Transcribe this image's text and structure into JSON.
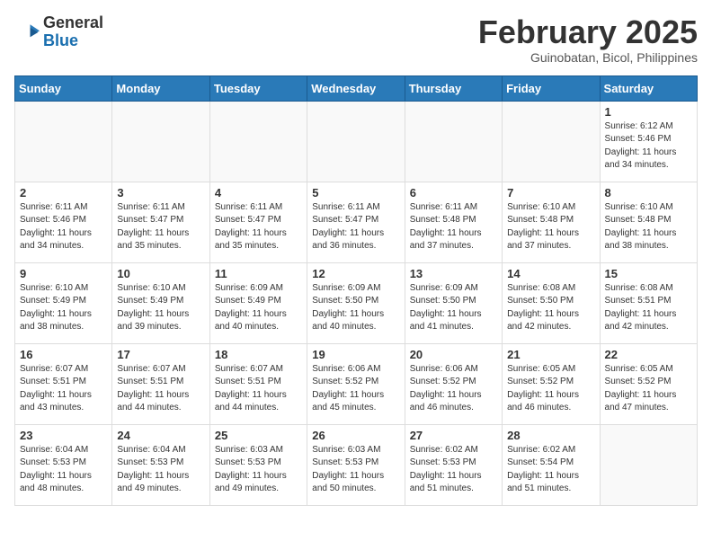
{
  "header": {
    "logo_general": "General",
    "logo_blue": "Blue",
    "month_year": "February 2025",
    "location": "Guinobatan, Bicol, Philippines"
  },
  "weekdays": [
    "Sunday",
    "Monday",
    "Tuesday",
    "Wednesday",
    "Thursday",
    "Friday",
    "Saturday"
  ],
  "weeks": [
    [
      {
        "day": "",
        "info": ""
      },
      {
        "day": "",
        "info": ""
      },
      {
        "day": "",
        "info": ""
      },
      {
        "day": "",
        "info": ""
      },
      {
        "day": "",
        "info": ""
      },
      {
        "day": "",
        "info": ""
      },
      {
        "day": "1",
        "info": "Sunrise: 6:12 AM\nSunset: 5:46 PM\nDaylight: 11 hours\nand 34 minutes."
      }
    ],
    [
      {
        "day": "2",
        "info": "Sunrise: 6:11 AM\nSunset: 5:46 PM\nDaylight: 11 hours\nand 34 minutes."
      },
      {
        "day": "3",
        "info": "Sunrise: 6:11 AM\nSunset: 5:47 PM\nDaylight: 11 hours\nand 35 minutes."
      },
      {
        "day": "4",
        "info": "Sunrise: 6:11 AM\nSunset: 5:47 PM\nDaylight: 11 hours\nand 35 minutes."
      },
      {
        "day": "5",
        "info": "Sunrise: 6:11 AM\nSunset: 5:47 PM\nDaylight: 11 hours\nand 36 minutes."
      },
      {
        "day": "6",
        "info": "Sunrise: 6:11 AM\nSunset: 5:48 PM\nDaylight: 11 hours\nand 37 minutes."
      },
      {
        "day": "7",
        "info": "Sunrise: 6:10 AM\nSunset: 5:48 PM\nDaylight: 11 hours\nand 37 minutes."
      },
      {
        "day": "8",
        "info": "Sunrise: 6:10 AM\nSunset: 5:48 PM\nDaylight: 11 hours\nand 38 minutes."
      }
    ],
    [
      {
        "day": "9",
        "info": "Sunrise: 6:10 AM\nSunset: 5:49 PM\nDaylight: 11 hours\nand 38 minutes."
      },
      {
        "day": "10",
        "info": "Sunrise: 6:10 AM\nSunset: 5:49 PM\nDaylight: 11 hours\nand 39 minutes."
      },
      {
        "day": "11",
        "info": "Sunrise: 6:09 AM\nSunset: 5:49 PM\nDaylight: 11 hours\nand 40 minutes."
      },
      {
        "day": "12",
        "info": "Sunrise: 6:09 AM\nSunset: 5:50 PM\nDaylight: 11 hours\nand 40 minutes."
      },
      {
        "day": "13",
        "info": "Sunrise: 6:09 AM\nSunset: 5:50 PM\nDaylight: 11 hours\nand 41 minutes."
      },
      {
        "day": "14",
        "info": "Sunrise: 6:08 AM\nSunset: 5:50 PM\nDaylight: 11 hours\nand 42 minutes."
      },
      {
        "day": "15",
        "info": "Sunrise: 6:08 AM\nSunset: 5:51 PM\nDaylight: 11 hours\nand 42 minutes."
      }
    ],
    [
      {
        "day": "16",
        "info": "Sunrise: 6:07 AM\nSunset: 5:51 PM\nDaylight: 11 hours\nand 43 minutes."
      },
      {
        "day": "17",
        "info": "Sunrise: 6:07 AM\nSunset: 5:51 PM\nDaylight: 11 hours\nand 44 minutes."
      },
      {
        "day": "18",
        "info": "Sunrise: 6:07 AM\nSunset: 5:51 PM\nDaylight: 11 hours\nand 44 minutes."
      },
      {
        "day": "19",
        "info": "Sunrise: 6:06 AM\nSunset: 5:52 PM\nDaylight: 11 hours\nand 45 minutes."
      },
      {
        "day": "20",
        "info": "Sunrise: 6:06 AM\nSunset: 5:52 PM\nDaylight: 11 hours\nand 46 minutes."
      },
      {
        "day": "21",
        "info": "Sunrise: 6:05 AM\nSunset: 5:52 PM\nDaylight: 11 hours\nand 46 minutes."
      },
      {
        "day": "22",
        "info": "Sunrise: 6:05 AM\nSunset: 5:52 PM\nDaylight: 11 hours\nand 47 minutes."
      }
    ],
    [
      {
        "day": "23",
        "info": "Sunrise: 6:04 AM\nSunset: 5:53 PM\nDaylight: 11 hours\nand 48 minutes."
      },
      {
        "day": "24",
        "info": "Sunrise: 6:04 AM\nSunset: 5:53 PM\nDaylight: 11 hours\nand 49 minutes."
      },
      {
        "day": "25",
        "info": "Sunrise: 6:03 AM\nSunset: 5:53 PM\nDaylight: 11 hours\nand 49 minutes."
      },
      {
        "day": "26",
        "info": "Sunrise: 6:03 AM\nSunset: 5:53 PM\nDaylight: 11 hours\nand 50 minutes."
      },
      {
        "day": "27",
        "info": "Sunrise: 6:02 AM\nSunset: 5:53 PM\nDaylight: 11 hours\nand 51 minutes."
      },
      {
        "day": "28",
        "info": "Sunrise: 6:02 AM\nSunset: 5:54 PM\nDaylight: 11 hours\nand 51 minutes."
      },
      {
        "day": "",
        "info": ""
      }
    ]
  ]
}
